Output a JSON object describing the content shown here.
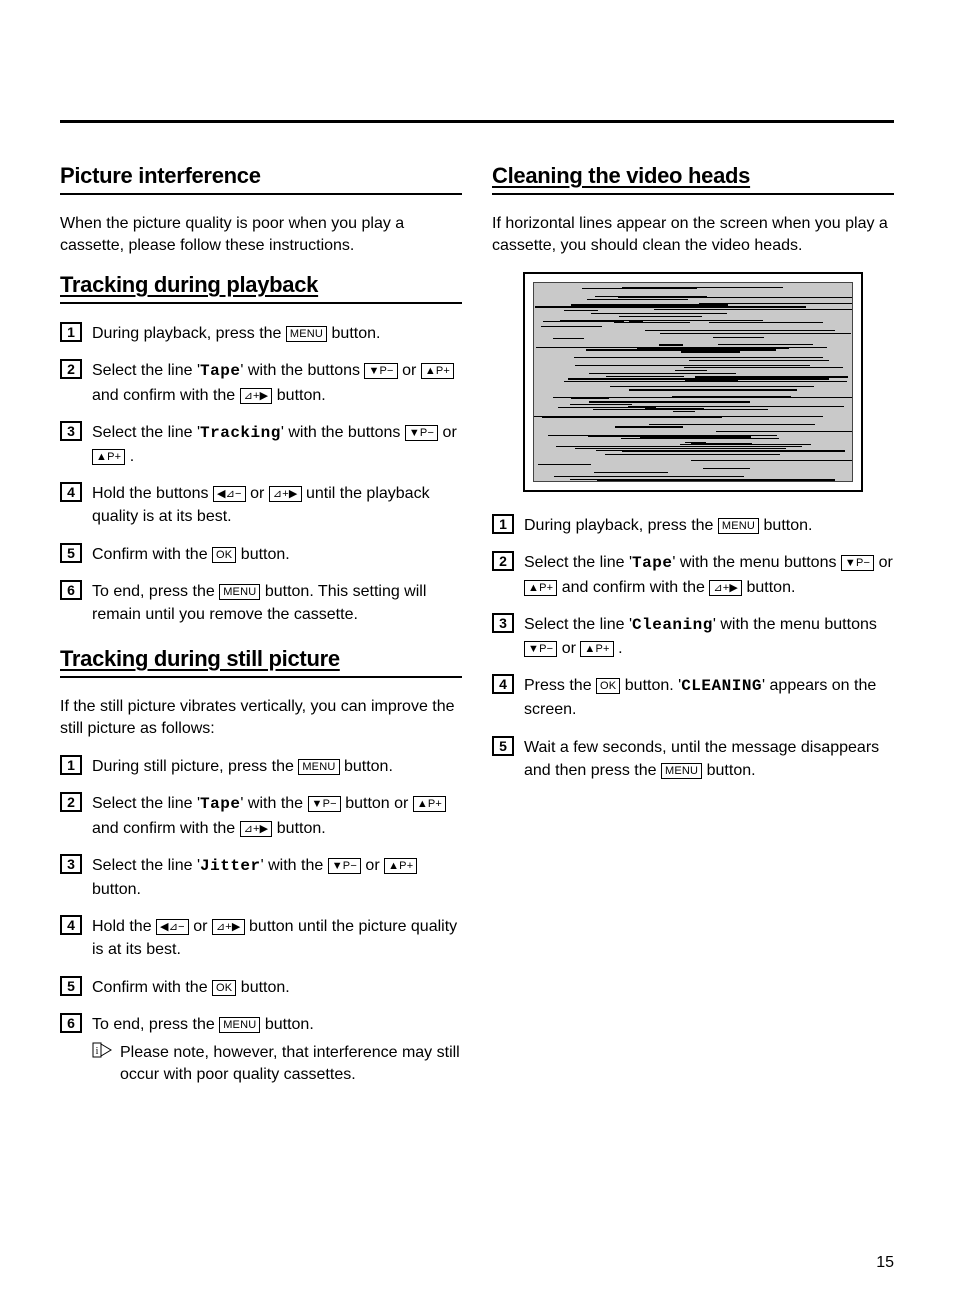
{
  "page_number": "15",
  "buttons": {
    "menu": "MENU",
    "ok": "OK",
    "p_down": "▼P−",
    "p_up": "▲P+",
    "right_plus": "⊿+▶",
    "left_minus": "◀⊿−"
  },
  "left": {
    "h1": "Picture interference",
    "intro": "When the picture quality is poor when you play a cassette, please follow these instructions.",
    "h2": "Tracking during playback",
    "tp": {
      "s1a": "During playback, press the ",
      "s1b": " button.",
      "s2a": "Select the line '",
      "s2tape": "Tape",
      "s2b": "' with the buttons ",
      "s2c": " or ",
      "s2d": " and confirm with the ",
      "s2e": " button.",
      "s3a": "Select the line '",
      "s3track": "Tracking",
      "s3b": "' with the buttons ",
      "s3c": " or ",
      "s3d": " .",
      "s4a": "Hold the buttons ",
      "s4b": " or ",
      "s4c": " until the playback quality is at its best.",
      "s5a": "Confirm with the ",
      "s5b": " button.",
      "s6a": "To end, press the ",
      "s6b": " button. This setting will remain until you remove the cassette."
    },
    "h3": "Tracking during still picture",
    "sp_intro": "If the still picture vibrates vertically, you can improve the still picture as follows:",
    "sp": {
      "s1a": "During still picture, press the ",
      "s1b": " button.",
      "s2a": "Select the line '",
      "s2tape": "Tape",
      "s2b": "' with the ",
      "s2c": " button or ",
      "s2d": " and confirm with the ",
      "s2e": " button.",
      "s3a": "Select the line '",
      "s3jit": "Jitter",
      "s3b": "' with the ",
      "s3c": " or ",
      "s3d": " button.",
      "s4a": "Hold the ",
      "s4b": " or ",
      "s4c": " button until the picture quality is at its best.",
      "s5a": "Confirm with the ",
      "s5b": " button.",
      "s6a": "To end, press the ",
      "s6b": " button.",
      "note": "Please note, however, that interference may still occur with poor quality cassettes."
    }
  },
  "right": {
    "h1": "Cleaning the video heads",
    "intro": "If horizontal lines appear on the screen when you play a cassette, you should clean the video heads.",
    "cl": {
      "s1a": "During playback, press the ",
      "s1b": " button.",
      "s2a": "Select the line '",
      "s2tape": "Tape",
      "s2b": "' with the menu buttons ",
      "s2c": " or ",
      "s2d": " and confirm with the ",
      "s2e": " button.",
      "s3a": "Select the line '",
      "s3clean": "Cleaning",
      "s3b": "' with the menu buttons ",
      "s3c": " or ",
      "s3d": " .",
      "s4a": "Press the ",
      "s4b": " button. '",
      "s4clean": "CLEANING",
      "s4c": "' appears on the screen.",
      "s5": "Wait a few seconds, until the message disappears and then press the ",
      "s5b": " button."
    }
  }
}
